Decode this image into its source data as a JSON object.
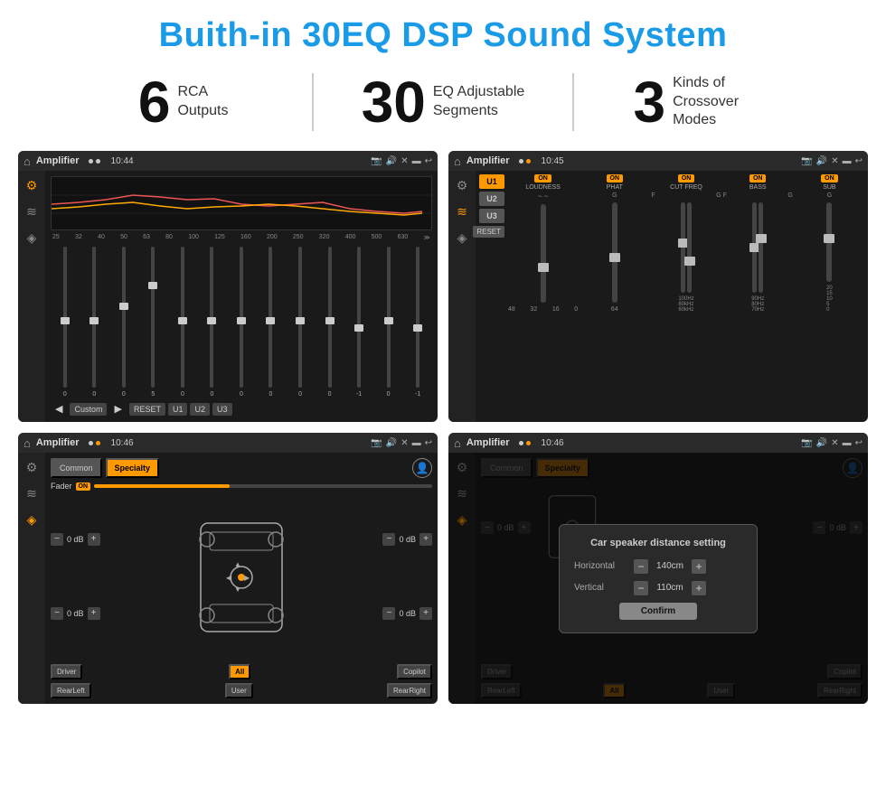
{
  "page": {
    "title": "Buith-in 30EQ DSP Sound System"
  },
  "stats": [
    {
      "number": "6",
      "label": "RCA\nOutputs"
    },
    {
      "number": "30",
      "label": "EQ Adjustable\nSegments"
    },
    {
      "number": "3",
      "label": "Kinds of\nCrossover Modes"
    }
  ],
  "screens": [
    {
      "id": "eq-screen",
      "status_bar": {
        "app": "Amplifier",
        "time": "10:44"
      },
      "eq_freqs": [
        "25",
        "32",
        "40",
        "50",
        "63",
        "80",
        "100",
        "125",
        "160",
        "200",
        "250",
        "320",
        "400",
        "500",
        "630"
      ],
      "eq_vals": [
        "0",
        "0",
        "0",
        "5",
        "0",
        "0",
        "0",
        "0",
        "0",
        "0",
        "0",
        "-1",
        "0",
        "-1",
        ""
      ],
      "buttons": [
        "Custom",
        "RESET",
        "U1",
        "U2",
        "U3"
      ]
    },
    {
      "id": "crossover-screen",
      "status_bar": {
        "app": "Amplifier",
        "time": "10:45"
      },
      "presets": [
        "U1",
        "U2",
        "U3"
      ],
      "channels": [
        "LOUDNESS",
        "PHAT",
        "CUT FREQ",
        "BASS",
        "SUB"
      ]
    },
    {
      "id": "speaker-pos-screen",
      "status_bar": {
        "app": "Amplifier",
        "time": "10:46"
      },
      "tabs": [
        "Common",
        "Specialty"
      ],
      "fader_label": "Fader",
      "fader_on": "ON",
      "db_values": [
        "0 dB",
        "0 dB",
        "0 dB",
        "0 dB"
      ],
      "buttons": [
        "Driver",
        "Copilot",
        "RearLeft",
        "All",
        "User",
        "RearRight"
      ]
    },
    {
      "id": "dialog-screen",
      "status_bar": {
        "app": "Amplifier",
        "time": "10:46"
      },
      "tabs": [
        "Common",
        "Specialty"
      ],
      "dialog": {
        "title": "Car speaker distance setting",
        "horizontal_label": "Horizontal",
        "horizontal_val": "140cm",
        "vertical_label": "Vertical",
        "vertical_val": "110cm",
        "confirm_label": "Confirm"
      },
      "db_values": [
        "0 dB",
        "0 dB"
      ],
      "buttons": [
        "Driver",
        "Copilot",
        "RearLeft",
        "All",
        "User",
        "RearRight"
      ]
    }
  ]
}
